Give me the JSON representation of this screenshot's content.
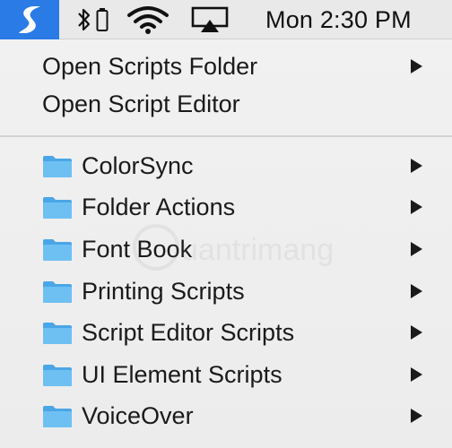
{
  "menubar": {
    "icons": [
      "script-menu-icon",
      "bluetooth-icon",
      "battery-icon",
      "wifi-icon",
      "airplay-icon"
    ],
    "clock": "Mon 2:30 PM",
    "accent_color": "#2a7be6"
  },
  "menu": {
    "top_items": [
      {
        "label": "Open Scripts Folder",
        "has_submenu": true
      },
      {
        "label": "Open Script Editor",
        "has_submenu": false
      }
    ],
    "folders": [
      {
        "label": "ColorSync",
        "icon": "folder-icon"
      },
      {
        "label": "Folder Actions",
        "icon": "folder-icon"
      },
      {
        "label": "Font Book",
        "icon": "folder-icon"
      },
      {
        "label": "Printing Scripts",
        "icon": "folder-icon"
      },
      {
        "label": "Script Editor Scripts",
        "icon": "folder-icon"
      },
      {
        "label": "UI Element Scripts",
        "icon": "folder-icon"
      },
      {
        "label": "VoiceOver",
        "icon": "folder-icon"
      }
    ],
    "folder_color": "#5fb6ef"
  },
  "watermark": {
    "text": "uantrimang"
  }
}
